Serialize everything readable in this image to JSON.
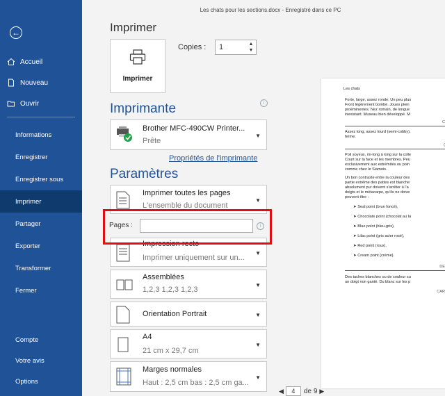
{
  "window_title": "Les chats pour les sections.docx  -  Enregistré dans ce PC",
  "sidebar": {
    "top_items": [
      {
        "label": "Accueil",
        "icon": "home-icon"
      },
      {
        "label": "Nouveau",
        "icon": "new-document-icon"
      },
      {
        "label": "Ouvrir",
        "icon": "open-folder-icon"
      }
    ],
    "mid_items": [
      "Informations",
      "Enregistrer",
      "Enregistrer sous",
      "Imprimer",
      "Partager",
      "Exporter",
      "Transformer",
      "Fermer"
    ],
    "bottom_items": [
      "Compte",
      "Votre avis",
      "Options"
    ],
    "active": "Imprimer"
  },
  "print": {
    "title": "Imprimer",
    "button_label": "Imprimer",
    "copies_label": "Copies :",
    "copies_value": "1"
  },
  "printer": {
    "heading": "Imprimante",
    "name": "Brother MFC-490CW Printer...",
    "status": "Prête",
    "properties_link": "Propriétés de l'imprimante"
  },
  "settings": {
    "heading": "Paramètres",
    "range_title": "Imprimer toutes les pages",
    "range_sub": "L'ensemble du document",
    "pages_label": "Pages :",
    "pages_value": "",
    "sides_title": "Impression recto",
    "sides_sub": "Imprimer uniquement sur un...",
    "collate_title": "Assemblées",
    "collate_sub": "1,2,3   1,2,3   1,2,3",
    "orientation_title": "Orientation Portrait",
    "paper_title": "A4",
    "paper_sub": "21 cm x 29,7 cm",
    "margins_title": "Marges normales",
    "margins_sub": "Haut : 2,5 cm bas : 2,5 cm ga..."
  },
  "preview": {
    "header": "Les chats",
    "p1": [
      "Forte, large, assez ronde. Un peu plus",
      "Front légèrement bombé. Joues plein",
      "proéminentes. Nez romain, de longue",
      "inexistant. Museau bien développé. M"
    ],
    "h1": "C",
    "p2": [
      "Assez long, assez lourd (semi-cobby).",
      "ferme."
    ],
    "h2": "(",
    "p3": [
      "Poil soyeux, mi-long à long sur la colle",
      "Court sur la face et les membres. Peu",
      "exclusivement aux extrémités ou poin",
      "comme chez le Siamois."
    ],
    "p4": [
      "Un bon contraste entre la couleur des",
      "partie extrême des pattes est blanche",
      "absolument pur doivent s'arrêter à l'a",
      "doigts et le métacarpe, qu'ils ne doive",
      "peuvent être :"
    ],
    "bullets": [
      "Seal point (brun foncé),",
      "Chocolate point (chocolat au la",
      "Blue point (bleu-gris),",
      "Lilac point (gris acier rosé),",
      "Red point (roux),",
      "Cream point (crème)."
    ],
    "h3": "DE",
    "p5": [
      "Des taches blanches ou de couleur su",
      "un doigt non ganté. Du blanc sur les p"
    ],
    "h4": "CAR"
  },
  "pager": {
    "current": "4",
    "of": "de 9"
  },
  "colors": {
    "sidebar": "#1f5296",
    "active_item": "#0f3a6e",
    "accent": "#1f5296",
    "highlight": "#e01010"
  }
}
